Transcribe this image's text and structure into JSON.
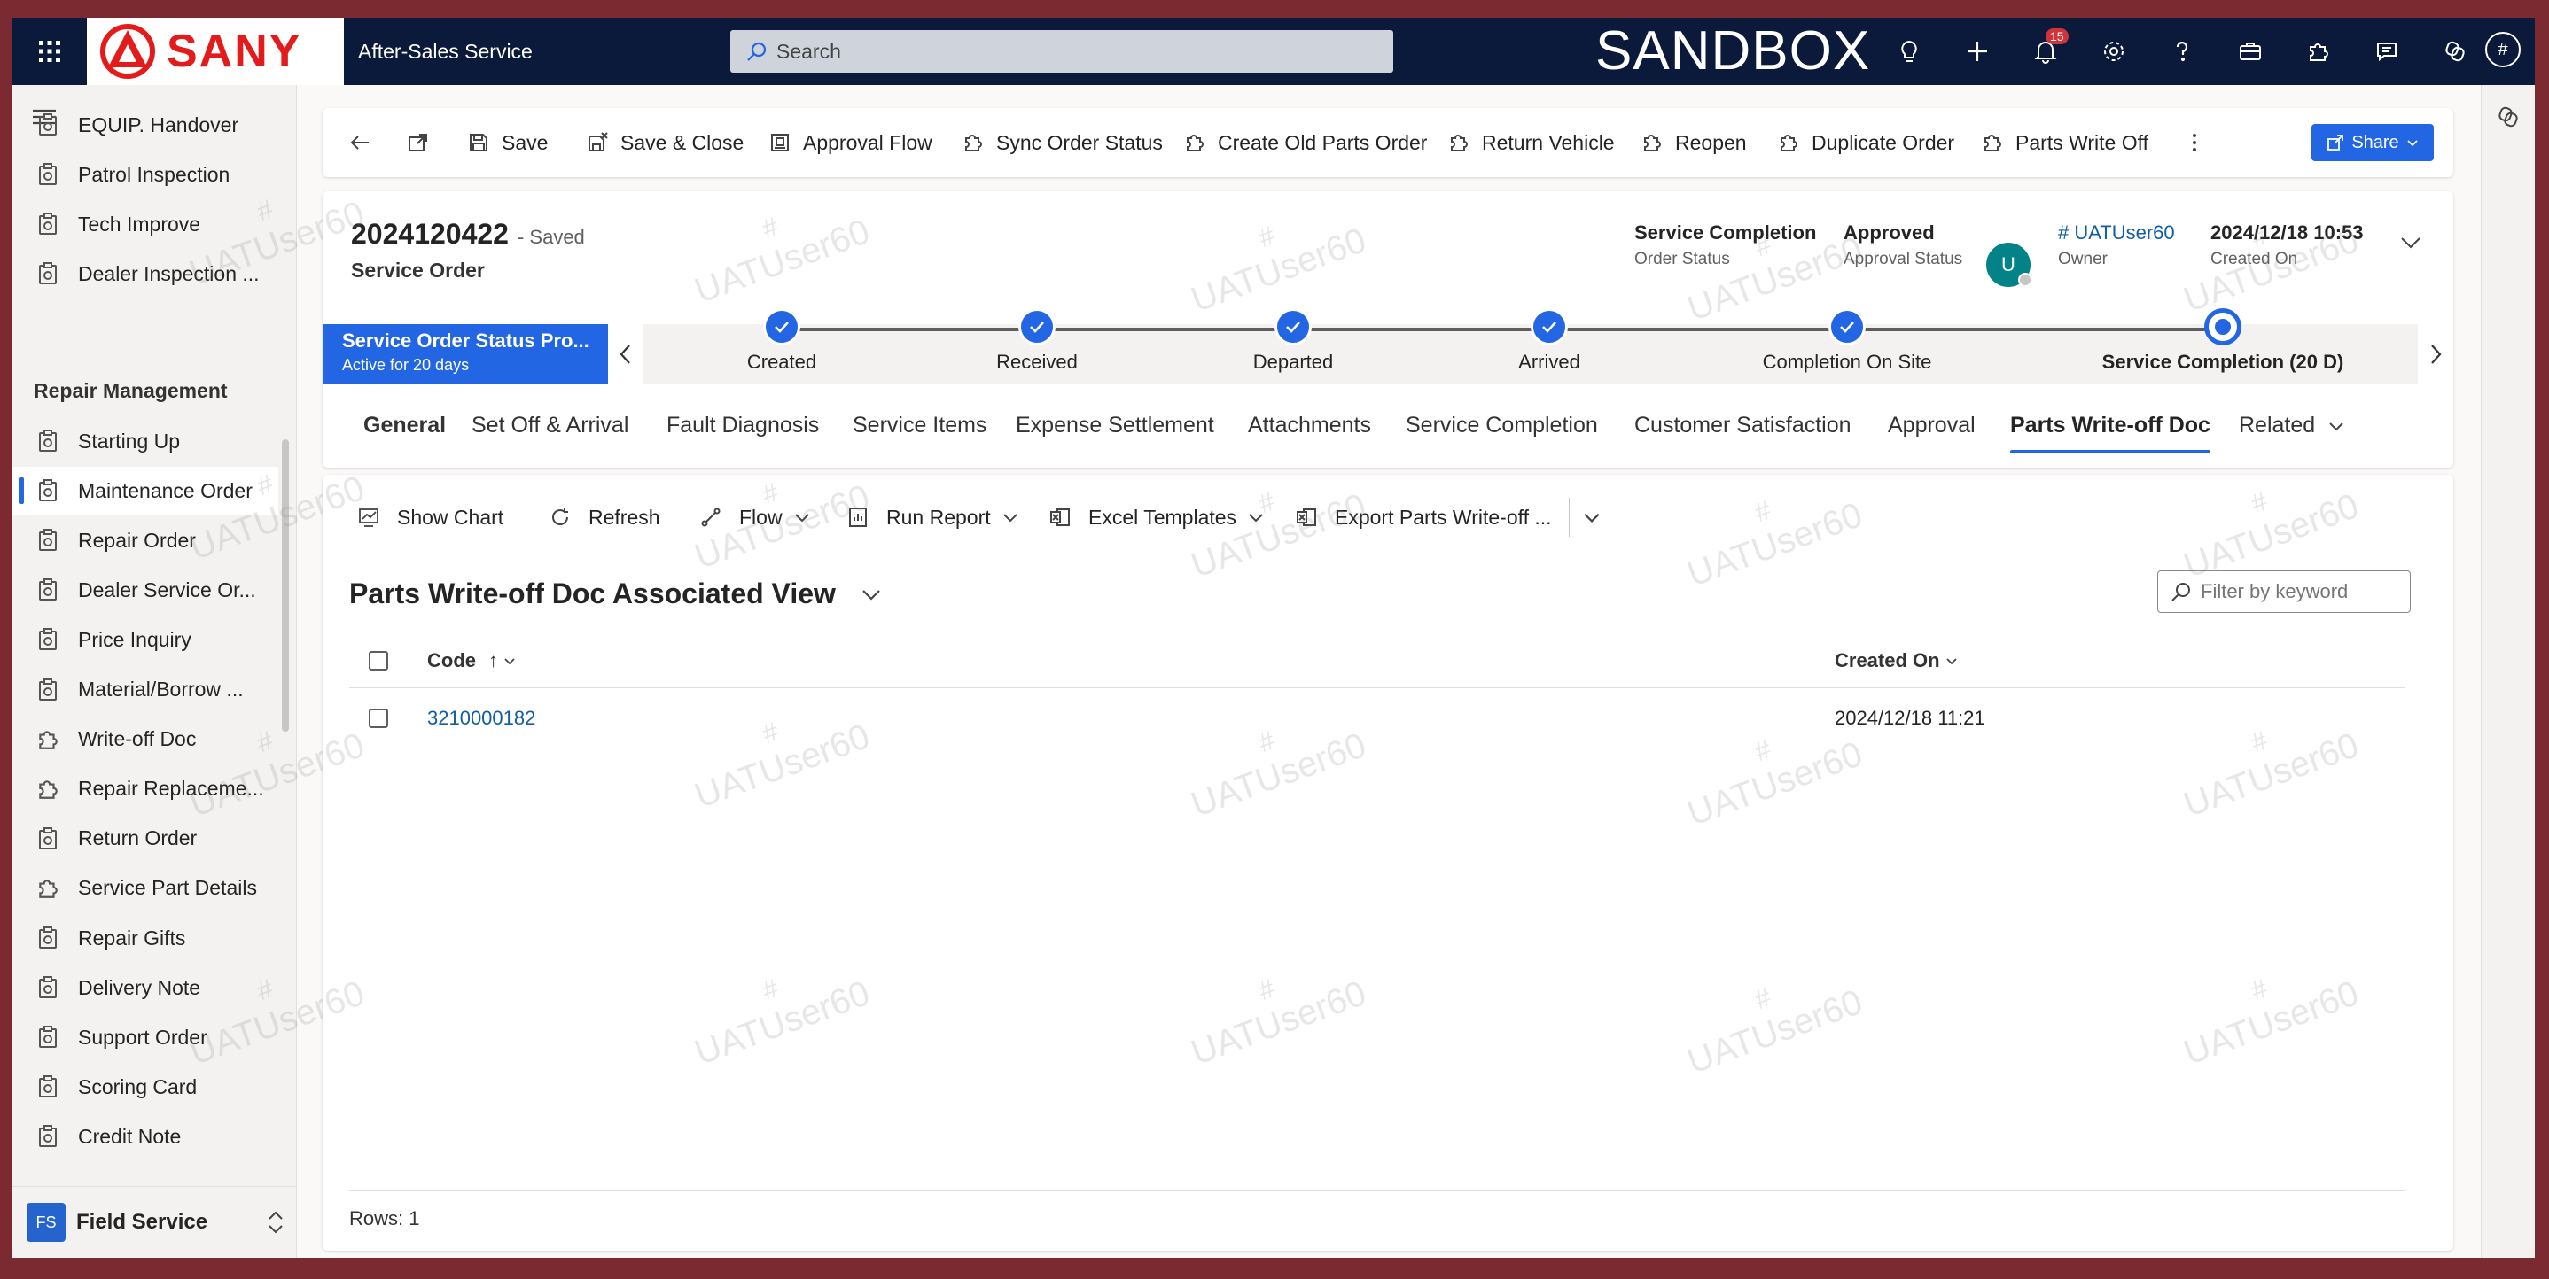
{
  "topbar": {
    "app_name": "After-Sales Service",
    "search_placeholder": "Search",
    "environment": "SANDBOX",
    "logo_text": "SANY",
    "notifications_count": "15",
    "user_initial": "#"
  },
  "sidebar": {
    "items_top": [
      {
        "label": "EQUIP. Handover"
      },
      {
        "label": "Patrol Inspection"
      },
      {
        "label": "Tech Improve"
      },
      {
        "label": "Dealer Inspection ..."
      }
    ],
    "group_title": "Repair Management",
    "items": [
      {
        "label": "Starting Up"
      },
      {
        "label": "Maintenance Order"
      },
      {
        "label": "Repair Order"
      },
      {
        "label": "Dealer Service Or..."
      },
      {
        "label": "Price Inquiry"
      },
      {
        "label": "Material/Borrow ..."
      },
      {
        "label": "Write-off Doc"
      },
      {
        "label": "Repair Replaceme..."
      },
      {
        "label": "Return Order"
      },
      {
        "label": "Service Part Details"
      },
      {
        "label": "Repair Gifts"
      },
      {
        "label": "Delivery Note"
      },
      {
        "label": "Support Order"
      },
      {
        "label": "Scoring Card"
      },
      {
        "label": "Credit Note"
      }
    ],
    "area_badge": "FS",
    "area_label": "Field Service"
  },
  "commands": {
    "save": "Save",
    "save_close": "Save & Close",
    "approval_flow": "Approval Flow",
    "sync_status": "Sync Order Status",
    "create_old_parts": "Create Old Parts Order",
    "return_vehicle": "Return Vehicle",
    "reopen": "Reopen",
    "duplicate": "Duplicate Order",
    "parts_write_off": "Parts Write Off",
    "share": "Share"
  },
  "record": {
    "number": "2024120422",
    "saved": "- Saved",
    "entity": "Service Order",
    "order_status_value": "Service Completion",
    "order_status_label": "Order Status",
    "approval_status_value": "Approved",
    "approval_status_label": "Approval Status",
    "owner_initial": "U",
    "owner_name": "# UATUser60",
    "owner_label": "Owner",
    "created_on_value": "2024/12/18 10:53",
    "created_on_label": "Created On"
  },
  "bpf": {
    "process_name": "Service Order Status Pro...",
    "active_for": "Active for 20 days",
    "stages": [
      {
        "label": "Created"
      },
      {
        "label": "Received"
      },
      {
        "label": "Departed"
      },
      {
        "label": "Arrived"
      },
      {
        "label": "Completion On Site"
      },
      {
        "label": "Service Completion  (20 D)"
      }
    ]
  },
  "tabs": [
    {
      "label": "General"
    },
    {
      "label": "Set Off & Arrival"
    },
    {
      "label": "Fault Diagnosis"
    },
    {
      "label": "Service Items"
    },
    {
      "label": "Expense Settlement"
    },
    {
      "label": "Attachments"
    },
    {
      "label": "Service Completion"
    },
    {
      "label": "Customer Satisfaction"
    },
    {
      "label": "Approval"
    },
    {
      "label": "Parts Write-off Doc"
    },
    {
      "label": "Related"
    }
  ],
  "subgrid": {
    "show_chart": "Show Chart",
    "refresh": "Refresh",
    "flow": "Flow",
    "run_report": "Run Report",
    "excel_templates": "Excel Templates",
    "export": "Export Parts Write-off ...",
    "view_title": "Parts Write-off Doc Associated View",
    "filter_placeholder": "Filter by keyword",
    "columns": {
      "code": "Code",
      "created_on": "Created On"
    },
    "sort_arrow": "↑",
    "rows": [
      {
        "code": "3210000182",
        "created_on": "2024/12/18 11:21"
      }
    ],
    "footer": "Rows: 1"
  },
  "watermark": {
    "hash": "#",
    "text": "UATUser60"
  },
  "colors": {
    "accent": "#2266e3",
    "topbar": "#0b1a3a",
    "brand_red": "#e41b1b"
  }
}
